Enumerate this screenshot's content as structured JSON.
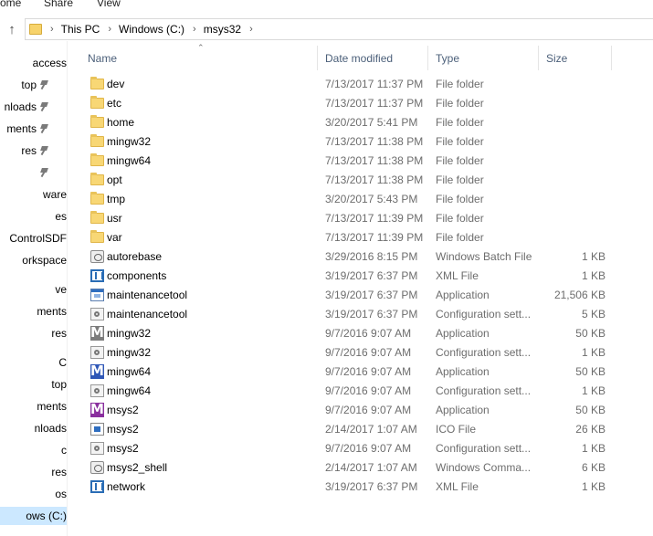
{
  "ribbon": {
    "tabs": [
      "ome",
      "Share",
      "View"
    ]
  },
  "address": {
    "crumbs": [
      "This PC",
      "Windows (C:)",
      "msys32"
    ]
  },
  "nav": {
    "items": [
      {
        "label": "access",
        "pinned": false,
        "selected": false
      },
      {
        "label": "top",
        "pinned": true,
        "selected": false
      },
      {
        "label": "nloads",
        "pinned": true,
        "selected": false
      },
      {
        "label": "ments",
        "pinned": true,
        "selected": false
      },
      {
        "label": "res",
        "pinned": true,
        "selected": false
      },
      {
        "label": "",
        "pinned": true,
        "selected": false
      },
      {
        "label": "ware",
        "pinned": false,
        "selected": false
      },
      {
        "label": "es",
        "pinned": false,
        "selected": false
      },
      {
        "label": "ControlSDF",
        "pinned": false,
        "selected": false
      },
      {
        "label": "orkspace",
        "pinned": false,
        "selected": false
      },
      {
        "label": "ve",
        "pinned": false,
        "selected": false
      },
      {
        "label": "ments",
        "pinned": false,
        "selected": false
      },
      {
        "label": "res",
        "pinned": false,
        "selected": false
      },
      {
        "label": "C",
        "pinned": false,
        "selected": false
      },
      {
        "label": "top",
        "pinned": false,
        "selected": false
      },
      {
        "label": "ments",
        "pinned": false,
        "selected": false
      },
      {
        "label": "nloads",
        "pinned": false,
        "selected": false
      },
      {
        "label": "c",
        "pinned": false,
        "selected": false
      },
      {
        "label": "res",
        "pinned": false,
        "selected": false
      },
      {
        "label": "os",
        "pinned": false,
        "selected": false
      },
      {
        "label": "ows (C:)",
        "pinned": false,
        "selected": true
      }
    ]
  },
  "columns": {
    "name": "Name",
    "date": "Date modified",
    "type": "Type",
    "size": "Size"
  },
  "files": [
    {
      "name": "dev",
      "date": "7/13/2017 11:37 PM",
      "type": "File folder",
      "size": "",
      "icon": "folder-icon"
    },
    {
      "name": "etc",
      "date": "7/13/2017 11:37 PM",
      "type": "File folder",
      "size": "",
      "icon": "folder-icon"
    },
    {
      "name": "home",
      "date": "3/20/2017 5:41 PM",
      "type": "File folder",
      "size": "",
      "icon": "folder-icon"
    },
    {
      "name": "mingw32",
      "date": "7/13/2017 11:38 PM",
      "type": "File folder",
      "size": "",
      "icon": "folder-icon"
    },
    {
      "name": "mingw64",
      "date": "7/13/2017 11:38 PM",
      "type": "File folder",
      "size": "",
      "icon": "folder-icon"
    },
    {
      "name": "opt",
      "date": "7/13/2017 11:38 PM",
      "type": "File folder",
      "size": "",
      "icon": "folder-icon"
    },
    {
      "name": "tmp",
      "date": "3/20/2017 5:43 PM",
      "type": "File folder",
      "size": "",
      "icon": "folder-icon"
    },
    {
      "name": "usr",
      "date": "7/13/2017 11:39 PM",
      "type": "File folder",
      "size": "",
      "icon": "folder-icon"
    },
    {
      "name": "var",
      "date": "7/13/2017 11:39 PM",
      "type": "File folder",
      "size": "",
      "icon": "folder-icon"
    },
    {
      "name": "autorebase",
      "date": "3/29/2016 8:15 PM",
      "type": "Windows Batch File",
      "size": "1 KB",
      "icon": "batch-file-icon"
    },
    {
      "name": "components",
      "date": "3/19/2017 6:37 PM",
      "type": "XML File",
      "size": "1 KB",
      "icon": "xml-file-icon"
    },
    {
      "name": "maintenancetool",
      "date": "3/19/2017 6:37 PM",
      "type": "Application",
      "size": "21,506 KB",
      "icon": "application-icon"
    },
    {
      "name": "maintenancetool",
      "date": "3/19/2017 6:37 PM",
      "type": "Configuration sett...",
      "size": "5 KB",
      "icon": "config-file-icon"
    },
    {
      "name": "mingw32",
      "date": "9/7/2016 9:07 AM",
      "type": "Application",
      "size": "50 KB",
      "icon": "mingw32-app-icon"
    },
    {
      "name": "mingw32",
      "date": "9/7/2016 9:07 AM",
      "type": "Configuration sett...",
      "size": "1 KB",
      "icon": "config-file-icon"
    },
    {
      "name": "mingw64",
      "date": "9/7/2016 9:07 AM",
      "type": "Application",
      "size": "50 KB",
      "icon": "mingw64-app-icon"
    },
    {
      "name": "mingw64",
      "date": "9/7/2016 9:07 AM",
      "type": "Configuration sett...",
      "size": "1 KB",
      "icon": "config-file-icon"
    },
    {
      "name": "msys2",
      "date": "9/7/2016 9:07 AM",
      "type": "Application",
      "size": "50 KB",
      "icon": "msys2-app-icon"
    },
    {
      "name": "msys2",
      "date": "2/14/2017 1:07 AM",
      "type": "ICO File",
      "size": "26 KB",
      "icon": "ico-file-icon"
    },
    {
      "name": "msys2",
      "date": "9/7/2016 9:07 AM",
      "type": "Configuration sett...",
      "size": "1 KB",
      "icon": "config-file-icon"
    },
    {
      "name": "msys2_shell",
      "date": "2/14/2017 1:07 AM",
      "type": "Windows Comma...",
      "size": "6 KB",
      "icon": "batch-file-icon"
    },
    {
      "name": "network",
      "date": "3/19/2017 6:37 PM",
      "type": "XML File",
      "size": "1 KB",
      "icon": "xml-file-icon"
    }
  ]
}
